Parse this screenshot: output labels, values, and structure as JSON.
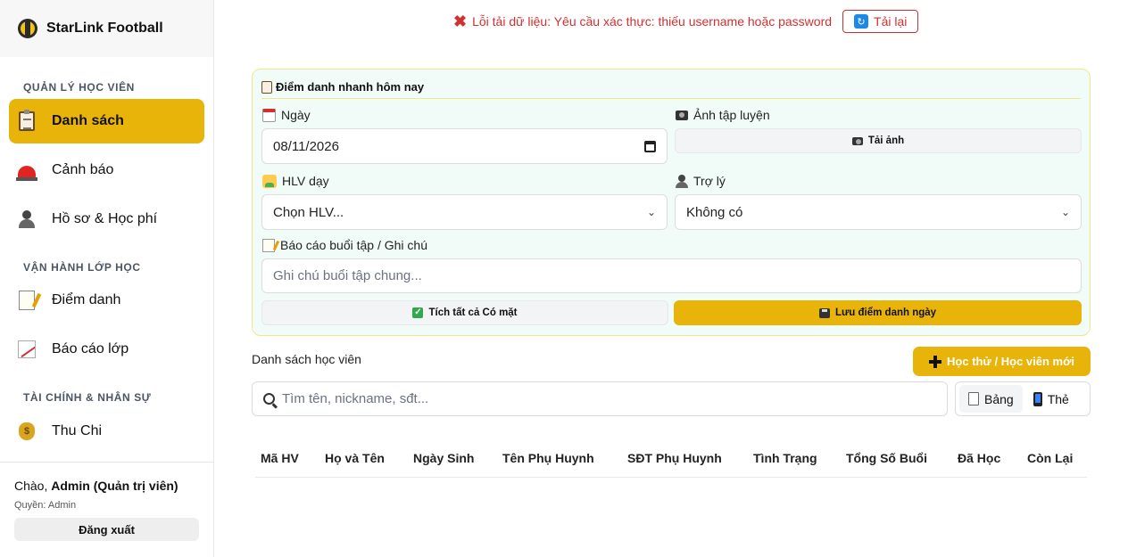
{
  "brand": {
    "name": "StarLink Football"
  },
  "sidebar": {
    "sections": [
      {
        "title": "QUẢN LÝ HỌC VIÊN"
      },
      {
        "title": "VẬN HÀNH LỚP HỌC"
      },
      {
        "title": "TÀI CHÍNH & NHÂN SỰ"
      }
    ],
    "items": [
      {
        "label": "Danh sách",
        "icon": "clipboard-icon",
        "active": true
      },
      {
        "label": "Cảnh báo",
        "icon": "siren-icon"
      },
      {
        "label": "Hồ sơ & Học phí",
        "icon": "person-icon"
      },
      {
        "label": "Điểm danh",
        "icon": "memo-icon"
      },
      {
        "label": "Báo cáo lớp",
        "icon": "chart-icon"
      },
      {
        "label": "Thu Chi",
        "icon": "money-bag-icon"
      }
    ],
    "footer": {
      "greeting_prefix": "Chào, ",
      "user": "Admin (Quản trị viên)",
      "role": "Quyền: Admin",
      "logout_label": "Đăng xuất"
    }
  },
  "error": {
    "message": "Lỗi tải dữ liệu: Yêu cầu xác thực: thiếu username hoặc password",
    "reload_label": "Tải lại"
  },
  "attendance": {
    "title": "Điểm danh nhanh hôm nay",
    "date_label": "Ngày",
    "date_value": "08/11/2026",
    "photo_label": "Ảnh tập luyện",
    "upload_label": "Tải ảnh",
    "coach_label": "HLV dạy",
    "coach_value": "Chọn HLV...",
    "assistant_label": "Trợ lý",
    "assistant_value": "Không có",
    "notes_label": "Báo cáo buổi tập / Ghi chú",
    "notes_placeholder": "Ghi chú buổi tập chung...",
    "check_all_label": "Tích tất cả Có mặt",
    "save_label": "Lưu điểm danh ngày"
  },
  "students": {
    "title": "Danh sách học viên",
    "add_label": "Học thử / Học viên mới",
    "search_placeholder": "Tìm tên, nickname, sđt...",
    "view_table": "Bảng",
    "view_card": "Thẻ",
    "columns": [
      "Mã HV",
      "Họ và Tên",
      "Ngày Sinh",
      "Tên Phụ Huynh",
      "SĐT Phụ Huynh",
      "Tình Trạng",
      "Tổng Số Buổi",
      "Đã Học",
      "Còn Lại"
    ]
  },
  "colors": {
    "accent": "#e8b40a",
    "error": "#d32f2f",
    "card_bg": "#f1fcf9"
  }
}
